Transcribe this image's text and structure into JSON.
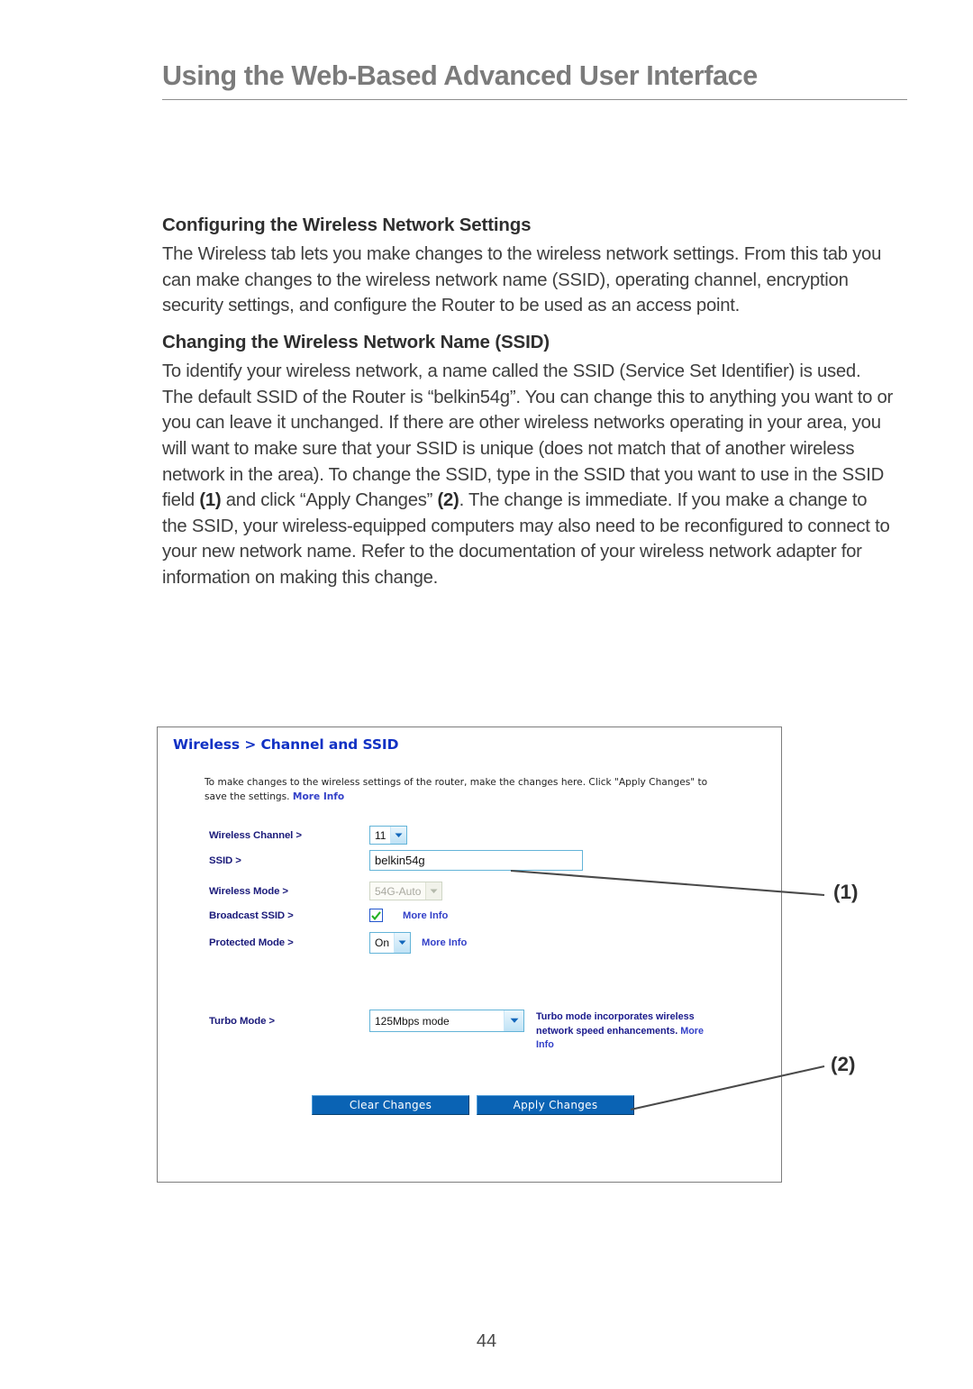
{
  "header": {
    "title": "Using the Web-Based Advanced User Interface"
  },
  "content": {
    "section1": {
      "heading": "Configuring the Wireless Network Settings",
      "paragraph": "The Wireless tab lets you make changes to the wireless network settings. From this tab you can make changes to the wireless network name (SSID), operating channel, encryption security settings, and configure the Router to be used as an access point."
    },
    "section2": {
      "heading": "Changing the Wireless Network Name (SSID)",
      "para_part1": "To identify your wireless network, a name called the SSID (Service Set Identifier) is used. The default SSID of the Router is “belkin54g”. You can change this to anything you want to or you can leave it unchanged. If there are other wireless networks operating in your area, you will want to make sure that your SSID is unique (does not match that of another wireless network in the area). To change the SSID, type in the SSID that you want to use in the SSID field ",
      "ref1": "(1)",
      "para_part2": " and click “Apply Changes” ",
      "ref2": "(2)",
      "para_part3": ". The change is immediate. If you make a change to the SSID, your wireless-equipped computers may also need to be reconfigured to connect to your new network name. Refer to the documentation of your wireless network adapter for information on making this change."
    }
  },
  "ui_panel": {
    "title": "Wireless > Channel and SSID",
    "intro_plain_1": "To make changes to the wireless settings of the router, make the changes here. Click \"Apply Changes\" to save the settings. ",
    "intro_more_info": "More Info",
    "fields": {
      "wireless_channel": {
        "label": "Wireless Channel >",
        "value": "11"
      },
      "ssid": {
        "label": "SSID >",
        "value": "belkin54g"
      },
      "wireless_mode": {
        "label": "Wireless Mode >",
        "value": "54G-Auto"
      },
      "broadcast_ssid": {
        "label": "Broadcast SSID >",
        "checked": true,
        "more_info": "More Info"
      },
      "protected_mode": {
        "label": "Protected Mode >",
        "value": "On",
        "more_info": "More Info"
      },
      "turbo_mode": {
        "label": "Turbo Mode >",
        "value": "125Mbps mode",
        "help_text": "Turbo mode incorporates wireless network speed enhancements. ",
        "help_more_info": "More Info"
      }
    },
    "buttons": {
      "clear": "Clear Changes",
      "apply": "Apply Changes"
    }
  },
  "callouts": {
    "one": "(1)",
    "two": "(2)"
  },
  "page_number": "44",
  "colors": {
    "header_gray": "#7b7b7b",
    "panel_link_blue": "#1131c4",
    "label_blue": "#1a1a7a",
    "button_blue": "#0a63b4",
    "input_border_blue": "#63b4d8",
    "check_green": "#22b022"
  }
}
